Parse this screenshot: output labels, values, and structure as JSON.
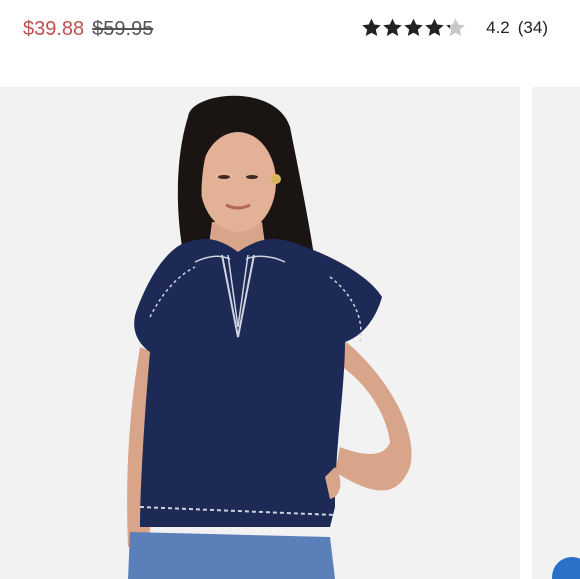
{
  "product": {
    "sale_price": "$39.88",
    "original_price": "$59.95",
    "rating": "4.2",
    "review_count": "(34)",
    "rating_stars": 4.2,
    "max_stars": 5
  },
  "colors": {
    "sale_price": "#c0504d",
    "star_filled": "#222222",
    "star_empty": "#c8c8c8",
    "image_background": "#f2f2f2",
    "top_navy": "#1c2a55"
  },
  "icons": {
    "star": "star-icon"
  }
}
